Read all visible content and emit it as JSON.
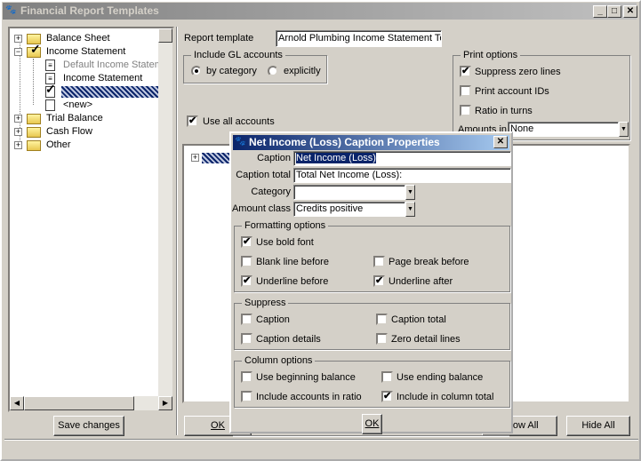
{
  "window": {
    "title": "Financial Report Templates",
    "controls": [
      "_",
      "□",
      "✕"
    ]
  },
  "tree": {
    "items": [
      {
        "label": "Balance Sheet",
        "expanded": false
      },
      {
        "label": "Income Statement",
        "expanded": true,
        "checked": true,
        "children": [
          {
            "label": "Default Income Statemer",
            "disabled": true
          },
          {
            "label": "Income Statement"
          },
          {
            "label": "",
            "selected": true,
            "checked": true
          },
          {
            "label": "<new>"
          }
        ]
      },
      {
        "label": "Trial Balance",
        "expanded": false
      },
      {
        "label": "Cash Flow",
        "expanded": false
      },
      {
        "label": "Other",
        "expanded": false
      }
    ]
  },
  "left_buttons": {
    "save": "Save changes"
  },
  "main": {
    "report_template_label": "Report template",
    "report_template_value": "Arnold Plumbing Income Statement Te",
    "include_gl": {
      "title": "Include GL accounts",
      "by_category": "by category",
      "explicitly": "explicitly",
      "selected": "by category"
    },
    "use_all_accounts": {
      "label": "Use all accounts",
      "checked": true
    },
    "print_options": {
      "title": "Print options",
      "suppress_zero": {
        "label": "Suppress zero lines",
        "checked": true
      },
      "print_ids": {
        "label": "Print account IDs",
        "checked": false
      },
      "ratio_turns": {
        "label": "Ratio in turns",
        "checked": false
      },
      "amounts_in_label": "Amounts in",
      "amounts_in_value": "None"
    },
    "buttons": {
      "ok": "OK",
      "show_all": "Show All",
      "hide_all": "Hide All"
    }
  },
  "dialog": {
    "title": "Net Income (Loss) Caption Properties",
    "caption_label": "Caption",
    "caption_value": "Net Income (Loss)",
    "caption_total_label": "Caption total",
    "caption_total_value": "Total Net Income (Loss):",
    "category_label": "Category",
    "category_value": "",
    "amount_class_label": "Amount class",
    "amount_class_value": "Credits positive",
    "formatting": {
      "title": "Formatting options",
      "items": [
        {
          "label": "Use bold font",
          "checked": true
        },
        {
          "label": "Blank line before",
          "checked": false
        },
        {
          "label": "Page break before",
          "checked": false
        },
        {
          "label": "Underline before",
          "checked": true
        },
        {
          "label": "Underline after",
          "checked": true
        }
      ]
    },
    "suppress": {
      "title": "Suppress",
      "items": [
        {
          "label": "Caption",
          "checked": false
        },
        {
          "label": "Caption total",
          "checked": false
        },
        {
          "label": "Caption details",
          "checked": false
        },
        {
          "label": "Zero detail lines",
          "checked": false
        }
      ]
    },
    "column": {
      "title": "Column options",
      "items": [
        {
          "label": "Use beginning balance",
          "checked": false
        },
        {
          "label": "Use ending balance",
          "checked": false
        },
        {
          "label": "Include accounts in ratio",
          "checked": false
        },
        {
          "label": "Include in column total",
          "checked": true
        }
      ]
    },
    "ok": "OK"
  }
}
